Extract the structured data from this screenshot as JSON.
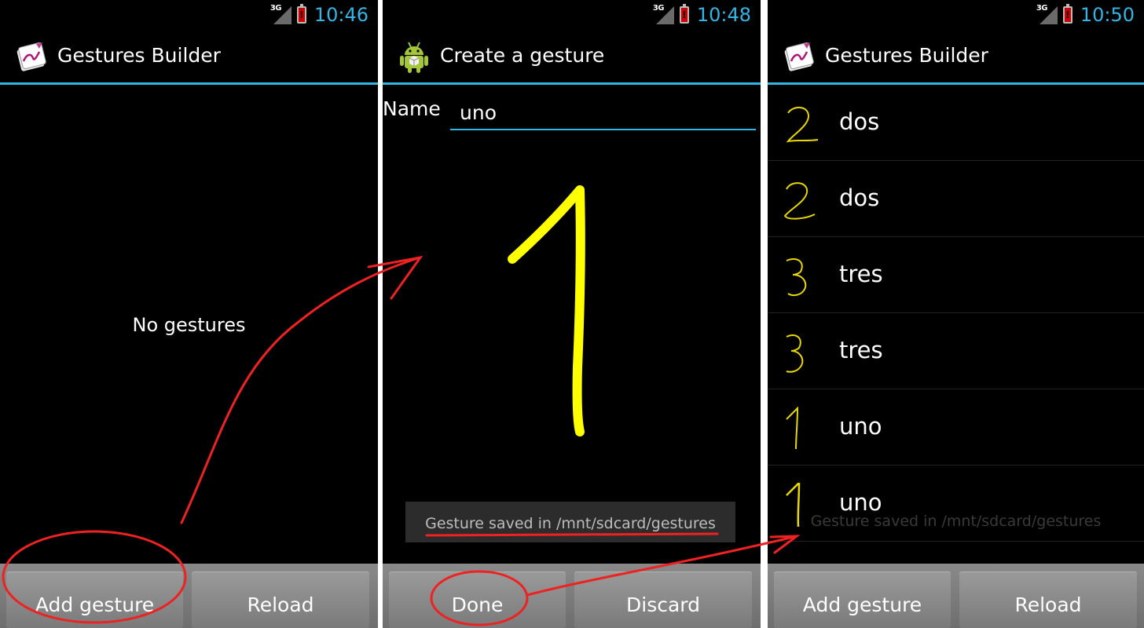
{
  "screen1": {
    "status": {
      "network": "3G",
      "time": "10:46"
    },
    "title": "Gestures Builder",
    "empty_message": "No gestures",
    "buttons": {
      "add": "Add gesture",
      "reload": "Reload"
    }
  },
  "screen2": {
    "status": {
      "network": "3G",
      "time": "10:48"
    },
    "title": "Create a gesture",
    "name_label": "Name",
    "name_value": "uno",
    "toast": "Gesture saved in /mnt/sdcard/gestures",
    "buttons": {
      "done": "Done",
      "discard": "Discard"
    }
  },
  "screen3": {
    "status": {
      "network": "3G",
      "time": "10:50"
    },
    "title": "Gestures Builder",
    "items": [
      {
        "name": "dos",
        "glyph": "2"
      },
      {
        "name": "dos",
        "glyph": "2"
      },
      {
        "name": "tres",
        "glyph": "3"
      },
      {
        "name": "tres",
        "glyph": "3"
      },
      {
        "name": "uno",
        "glyph": "1"
      },
      {
        "name": "uno",
        "glyph": "1"
      }
    ],
    "toast_ghost": "Gesture saved in /mnt/sdcard/gestures",
    "buttons": {
      "add": "Add gesture",
      "reload": "Reload"
    }
  },
  "colors": {
    "accent": "#33b5e5",
    "gesture_stroke": "#ffff00",
    "annotation": "#ee2222",
    "battery": "#cc0000"
  }
}
